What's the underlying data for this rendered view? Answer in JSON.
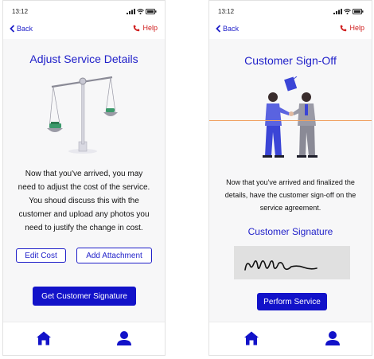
{
  "screen1": {
    "status": {
      "time": "13:12"
    },
    "nav": {
      "back_label": "Back",
      "help_label": "Help"
    },
    "title": "Adjust Service Details",
    "body_lines": [
      "Now that you've arrived, you may",
      "need to adjust the cost of the service.",
      "You shoud discuss this with the",
      "customer and upload any photos you",
      "need to justify the change in cost."
    ],
    "buttons": {
      "edit_cost": "Edit Cost",
      "add_attachment": "Add Attachment",
      "get_signature": "Get Customer Signature"
    },
    "tabs": [
      "home-icon",
      "user-icon"
    ]
  },
  "screen2": {
    "status": {
      "time": "13:12"
    },
    "nav": {
      "back_label": "Back",
      "help_label": "Help"
    },
    "title": "Customer Sign-Off",
    "body_lines": [
      "Now that you've arrived and finalized the",
      "details, have the customer sign-off on the",
      "service agreement."
    ],
    "signature_heading": "Customer Signature",
    "buttons": {
      "perform_service": "Perform Service"
    },
    "tabs": [
      "home-icon",
      "user-icon"
    ]
  },
  "colors": {
    "accent": "#1f1fc9",
    "button": "#1212c9",
    "help": "#d01e1e",
    "divider": "#f0a060"
  }
}
